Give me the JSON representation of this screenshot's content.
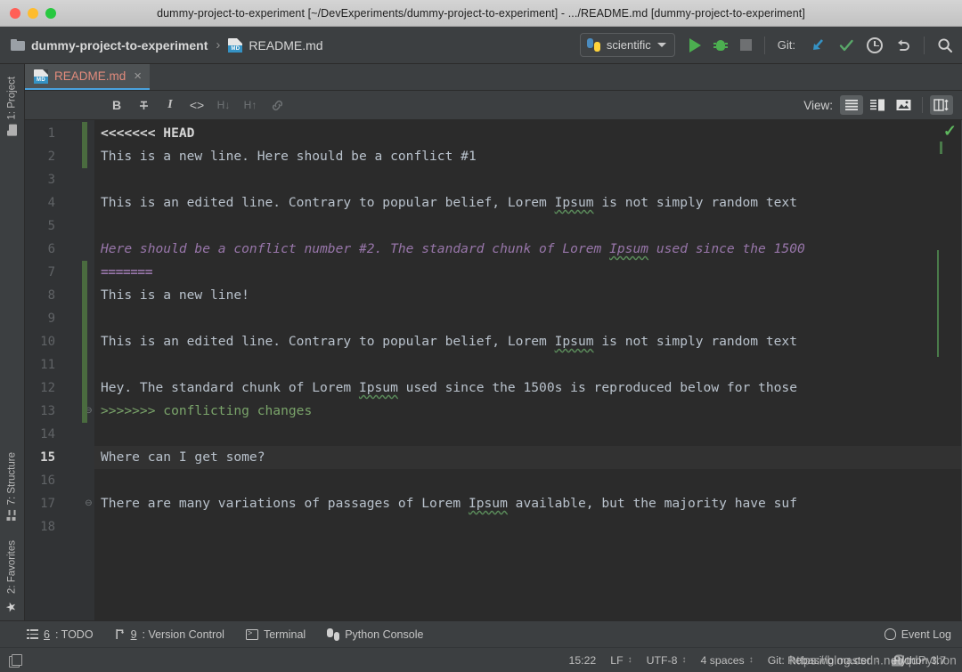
{
  "window": {
    "title": "dummy-project-to-experiment [~/DevExperiments/dummy-project-to-experiment] - .../README.md [dummy-project-to-experiment]",
    "traffic_lights": [
      "close-red",
      "minimize-yellow",
      "maximize-green"
    ]
  },
  "toolbar": {
    "breadcrumb": {
      "project": "dummy-project-to-experiment",
      "separator": "›",
      "file": "README.md",
      "file_icon_tag": "MD"
    },
    "run_config": {
      "label": "scientific",
      "icon": "python-icon",
      "caret": "chevron-down-icon"
    },
    "actions": [
      {
        "name": "run-button",
        "icon": "play-icon"
      },
      {
        "name": "debug-button",
        "icon": "bug-icon"
      },
      {
        "name": "stop-button",
        "icon": "stop-icon"
      }
    ],
    "git_label": "Git:",
    "git_actions": [
      {
        "name": "update-project-button",
        "icon": "arrow-down-left-icon",
        "color": "#3592c4"
      },
      {
        "name": "commit-button",
        "icon": "checkmark-icon",
        "color": "#59a869"
      },
      {
        "name": "history-button",
        "icon": "clock-icon"
      },
      {
        "name": "rollback-button",
        "icon": "revert-arrow-icon"
      }
    ],
    "search_action": {
      "name": "search-everywhere-button",
      "icon": "search-icon"
    }
  },
  "left_tool_window": {
    "items": [
      {
        "label": "1: Project",
        "icon": "folder-icon"
      },
      {
        "label": "7: Structure",
        "icon": "structure-icon"
      },
      {
        "label": "2: Favorites",
        "icon": "star-icon"
      }
    ]
  },
  "editor_tabs": [
    {
      "label": "README.md",
      "icon": "markdown-file-icon",
      "close": "×",
      "active": true
    }
  ],
  "markdown_toolbar": {
    "buttons": [
      {
        "name": "bold-button",
        "glyph": "B",
        "enabled": true
      },
      {
        "name": "strikethrough-button",
        "glyph": "†",
        "enabled": true
      },
      {
        "name": "italic-button",
        "glyph": "I",
        "enabled": true
      },
      {
        "name": "code-button",
        "glyph": "<>",
        "enabled": true
      },
      {
        "name": "header-decrease-button",
        "glyph": "H↓",
        "enabled": false
      },
      {
        "name": "header-increase-button",
        "glyph": "H↑",
        "enabled": false
      },
      {
        "name": "link-button",
        "glyph": "⚭",
        "enabled": false
      }
    ],
    "view_label": "View:",
    "view_buttons": [
      {
        "name": "view-editor-only-button",
        "icon": "lines-icon",
        "active": true
      },
      {
        "name": "view-editor-preview-button",
        "icon": "split-view-icon",
        "active": false
      },
      {
        "name": "view-preview-only-button",
        "icon": "image-icon",
        "active": false
      },
      {
        "name": "view-toggle-layout-button",
        "icon": "columns-resize-icon",
        "active": true
      }
    ]
  },
  "editor": {
    "inspection_status": "✓",
    "current_line": 15,
    "lines": [
      {
        "n": 1,
        "changed": true,
        "segments": [
          {
            "t": "<<<<<<< HEAD",
            "c": "conflict"
          }
        ]
      },
      {
        "n": 2,
        "changed": true,
        "segments": [
          {
            "t": "This is a new line. Here should be a conflict #1",
            "c": "plain"
          }
        ]
      },
      {
        "n": 3,
        "changed": false,
        "segments": []
      },
      {
        "n": 4,
        "changed": false,
        "segments": [
          {
            "t": "This is an edited line. Contrary to popular belief, Lorem ",
            "c": "plain"
          },
          {
            "t": "Ipsum",
            "c": "typo"
          },
          {
            "t": " is not simply random text",
            "c": "plain"
          }
        ]
      },
      {
        "n": 5,
        "changed": false,
        "segments": []
      },
      {
        "n": 6,
        "changed": false,
        "segments": [
          {
            "t": "Here should be a conflict number #2. The standard chunk of Lorem ",
            "c": "purple"
          },
          {
            "t": "Ipsum",
            "c": "purple-typo"
          },
          {
            "t": " used since the 1500",
            "c": "purple"
          }
        ]
      },
      {
        "n": 7,
        "changed": true,
        "segments": [
          {
            "t": "=======",
            "c": "purple-bold"
          }
        ]
      },
      {
        "n": 8,
        "changed": true,
        "segments": [
          {
            "t": "This is a new line!",
            "c": "plain"
          }
        ]
      },
      {
        "n": 9,
        "changed": true,
        "segments": []
      },
      {
        "n": 10,
        "changed": true,
        "segments": [
          {
            "t": "This is an edited line. Contrary to popular belief, Lorem ",
            "c": "plain"
          },
          {
            "t": "Ipsum",
            "c": "typo"
          },
          {
            "t": " is not simply random text",
            "c": "plain"
          }
        ]
      },
      {
        "n": 11,
        "changed": true,
        "segments": []
      },
      {
        "n": 12,
        "changed": true,
        "segments": [
          {
            "t": "Hey. The standard chunk of Lorem ",
            "c": "plain"
          },
          {
            "t": "Ipsum",
            "c": "typo"
          },
          {
            "t": " used since the 1500s is reproduced below for those",
            "c": "plain"
          }
        ]
      },
      {
        "n": 13,
        "changed": true,
        "fold": true,
        "segments": [
          {
            "t": ">>>>>>> conflicting changes",
            "c": "green"
          }
        ]
      },
      {
        "n": 14,
        "changed": false,
        "segments": []
      },
      {
        "n": 15,
        "changed": false,
        "segments": [
          {
            "t": "Where can I get some?",
            "c": "plain"
          }
        ]
      },
      {
        "n": 16,
        "changed": false,
        "segments": []
      },
      {
        "n": 17,
        "changed": false,
        "fold": true,
        "segments": [
          {
            "t": "There are many variations of passages of Lorem ",
            "c": "plain"
          },
          {
            "t": "Ipsum",
            "c": "typo"
          },
          {
            "t": " available, but the majority have suf",
            "c": "plain"
          }
        ]
      },
      {
        "n": 18,
        "changed": false,
        "segments": []
      }
    ]
  },
  "bottom_tool_bar": {
    "items": [
      {
        "label_prefix": "",
        "shortcut": "6",
        "label": ": TODO",
        "icon": "todo-list-icon",
        "name": "todo-tool-window"
      },
      {
        "label_prefix": "",
        "shortcut": "9",
        "label": ": Version Control",
        "icon": "branch-icon",
        "name": "version-control-tool-window"
      },
      {
        "label_prefix": "",
        "shortcut": "",
        "label": "Terminal",
        "icon": "terminal-icon",
        "name": "terminal-tool-window"
      },
      {
        "label_prefix": "",
        "shortcut": "",
        "label": "Python Console",
        "icon": "python-console-icon",
        "name": "python-console-tool-window"
      }
    ],
    "event_log": {
      "label": "Event Log",
      "icon": "bell-icon"
    }
  },
  "status_bar": {
    "cursor_position": "15:22",
    "line_separator": "LF",
    "encoding": "UTF-8",
    "indent": "4 spaces",
    "git_branch": "Git: Rebasing master",
    "interpreter": "Python 3.7",
    "watermark": "https://blog.csdn.net/qdPython",
    "stepper_glyph": "↕"
  },
  "colors": {
    "titlebar_bg": "#c9c9c9",
    "chrome_bg": "#3c3f41",
    "editor_bg": "#2b2b2b",
    "gutter_bg": "#313335",
    "accent_tab_underline": "#4aa3df",
    "tab_label": "#e28b7c",
    "changed_marker": "#4a6b3f",
    "conflict_purple": "#9876aa",
    "conflict_green": "#7aa46a",
    "run_green": "#4caf50",
    "git_blue": "#3592c4"
  }
}
